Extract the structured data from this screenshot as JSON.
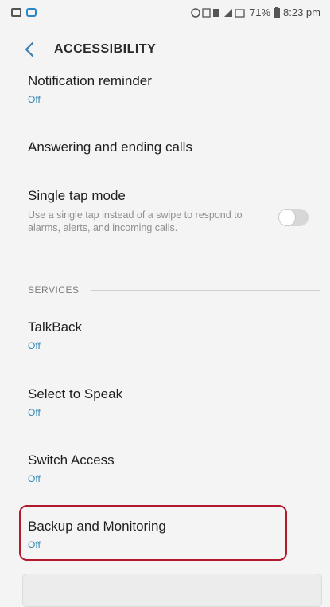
{
  "statusbar": {
    "battery": "71%",
    "time": "8:23 pm"
  },
  "header": {
    "title": "ACCESSIBILITY"
  },
  "items": [
    {
      "title": "Notification reminder",
      "sub": "Off"
    },
    {
      "title": "Answering and ending calls"
    },
    {
      "title": "Single tap mode",
      "desc": "Use a single tap instead of a swipe to respond to alarms, alerts, and incoming calls.",
      "toggle_on": false
    }
  ],
  "services": {
    "header": "SERVICES",
    "items": [
      {
        "title": "TalkBack",
        "sub": "Off"
      },
      {
        "title": "Select to Speak",
        "sub": "Off"
      },
      {
        "title": "Switch Access",
        "sub": "Off"
      },
      {
        "title": "Backup and Monitoring",
        "sub": "Off"
      }
    ]
  },
  "colors": {
    "accent": "#2f86b5",
    "highlight": "#b2192e"
  }
}
